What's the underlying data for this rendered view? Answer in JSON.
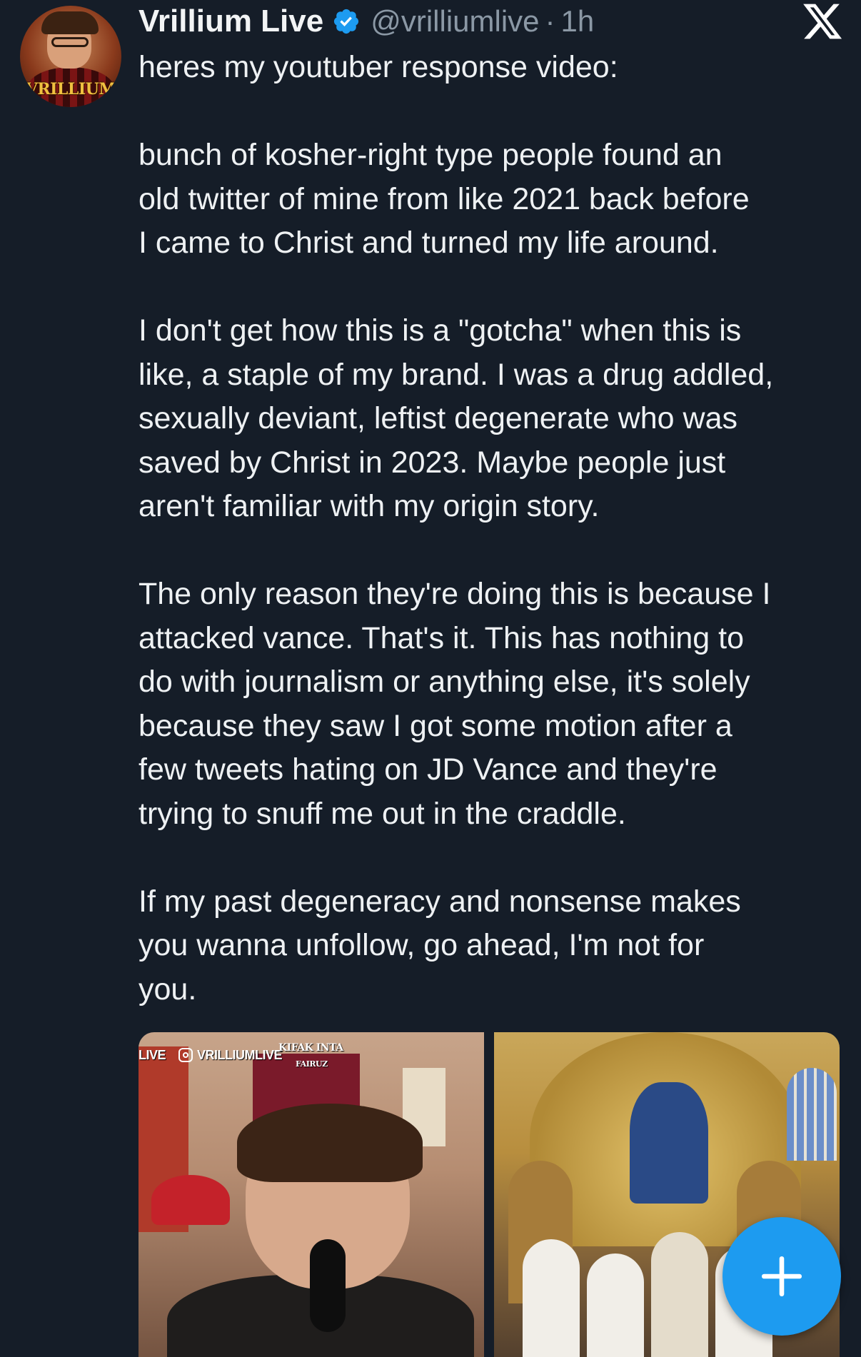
{
  "tweet": {
    "avatar_label": "VRILLIUM",
    "display_name": "Vrillium Live",
    "handle": "@vrilliumlive",
    "separator": "·",
    "time": "1h",
    "paragraphs": [
      "heres my youtuber response video:",
      "bunch of kosher-right type people found an\nold twitter of mine from like 2021 back before\nI came to Christ and turned my life around.",
      "I don't get how this is a \"gotcha\" when this is\nlike, a staple of my brand. I was a drug addled,\nsexually deviant, leftist degenerate who was\nsaved by Christ in 2023. Maybe people just\naren't familiar with my origin story.",
      "The only reason they're doing this is because I\nattacked vance. That's it. This has nothing to\ndo with journalism or anything else, it's solely\nbecause they saw I got some motion after a\nfew tweets hating on JD Vance and they're\ntrying to snuff me out in the craddle.",
      "If my past degeneracy and nonsense makes\nyou wanna unfollow, go ahead, I'm not for\nyou."
    ],
    "media": {
      "left_overlay_live": "LIVE",
      "left_overlay_handle": "VRILLIUMLIVE",
      "left_overlay_poster": "KIFAK INTA",
      "left_overlay_poster_sub": "FAIRUZ"
    }
  },
  "icons": {
    "verified": "verified-badge-icon",
    "close": "x-logo-icon",
    "compose": "plus-icon",
    "instagram": "instagram-icon"
  },
  "colors": {
    "background": "#151d28",
    "text": "#eef1f3",
    "secondary_text": "#8b98a5",
    "accent": "#1d9bf0"
  }
}
